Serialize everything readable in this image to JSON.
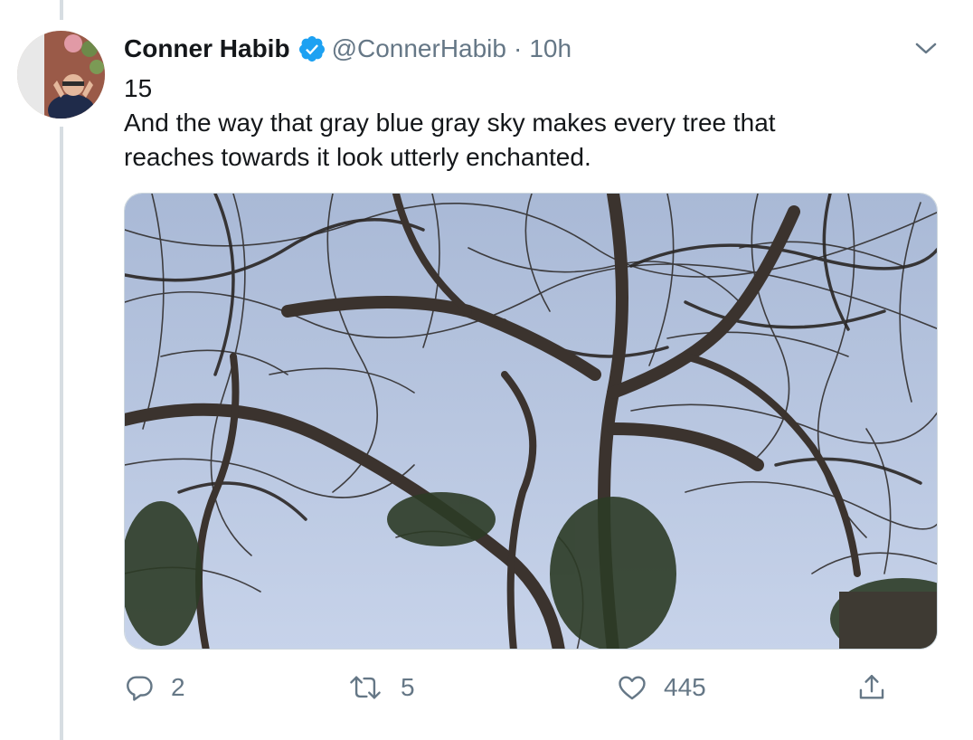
{
  "tweet": {
    "author_name": "Conner Habib",
    "handle": "@ConnerHabib",
    "separator": "·",
    "timestamp": "10h",
    "text_lines": [
      "15",
      "And the way that gray blue gray sky makes every tree that",
      "reaches towards it look utterly enchanted."
    ],
    "verified": true
  },
  "media": {
    "icon": "photo-bare-tree-icon"
  },
  "actions": {
    "reply_count": "2",
    "retweet_count": "5",
    "like_count": "445"
  },
  "colors": {
    "verified_badge": "#1da1f2",
    "secondary_text": "#657786",
    "primary_text": "#14171a",
    "sky": "#b9c7e0",
    "thread_line": "#d7dde2"
  }
}
